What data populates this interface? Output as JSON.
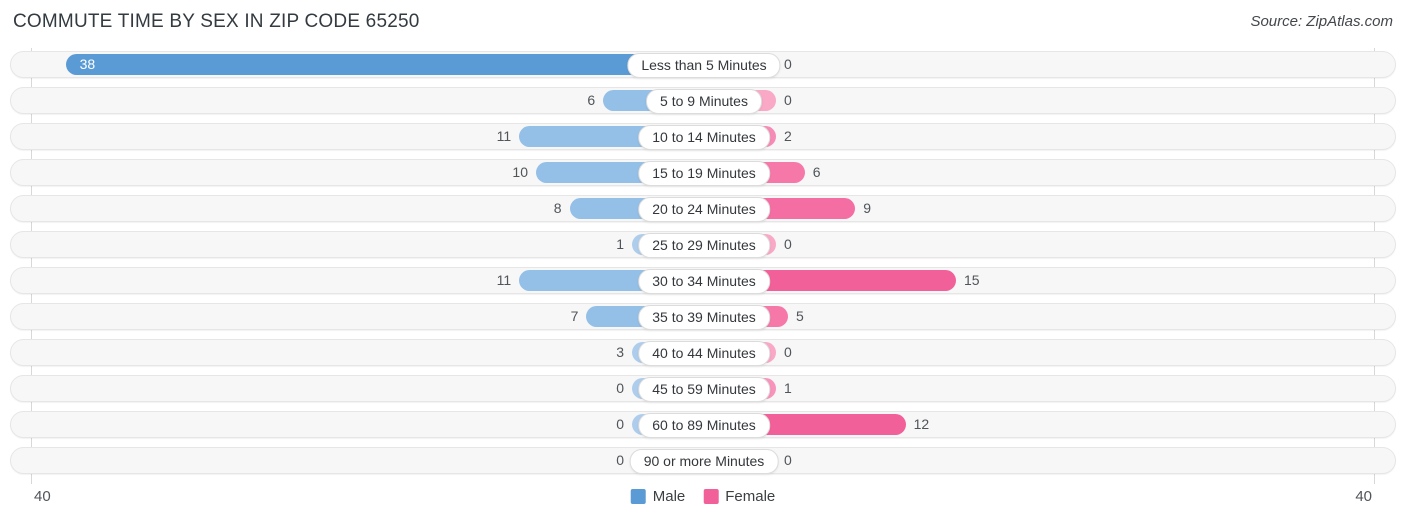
{
  "header": {
    "title": "COMMUTE TIME BY SEX IN ZIP CODE 65250",
    "source": "Source: ZipAtlas.com"
  },
  "legend": {
    "male_label": "Male",
    "female_label": "Female",
    "male_color": "#5b9bd5",
    "female_color": "#f2609a"
  },
  "axis": {
    "left_tick": "40",
    "right_tick": "40",
    "max": 40
  },
  "chart_data": {
    "type": "bar",
    "orientation": "horizontal-diverging",
    "title": "COMMUTE TIME BY SEX IN ZIP CODE 65250",
    "xlabel": "",
    "ylabel": "",
    "xlim": [
      40,
      40
    ],
    "grid": false,
    "legend_position": "bottom-center",
    "categories": [
      "Less than 5 Minutes",
      "5 to 9 Minutes",
      "10 to 14 Minutes",
      "15 to 19 Minutes",
      "20 to 24 Minutes",
      "25 to 29 Minutes",
      "30 to 34 Minutes",
      "35 to 39 Minutes",
      "40 to 44 Minutes",
      "45 to 59 Minutes",
      "60 to 89 Minutes",
      "90 or more Minutes"
    ],
    "series": [
      {
        "name": "Male",
        "color": "#5b9bd5",
        "values": [
          38,
          6,
          11,
          10,
          8,
          1,
          11,
          7,
          3,
          0,
          0,
          0
        ]
      },
      {
        "name": "Female",
        "color": "#f2609a",
        "values": [
          0,
          0,
          2,
          6,
          9,
          0,
          15,
          5,
          0,
          1,
          12,
          0
        ]
      }
    ]
  }
}
